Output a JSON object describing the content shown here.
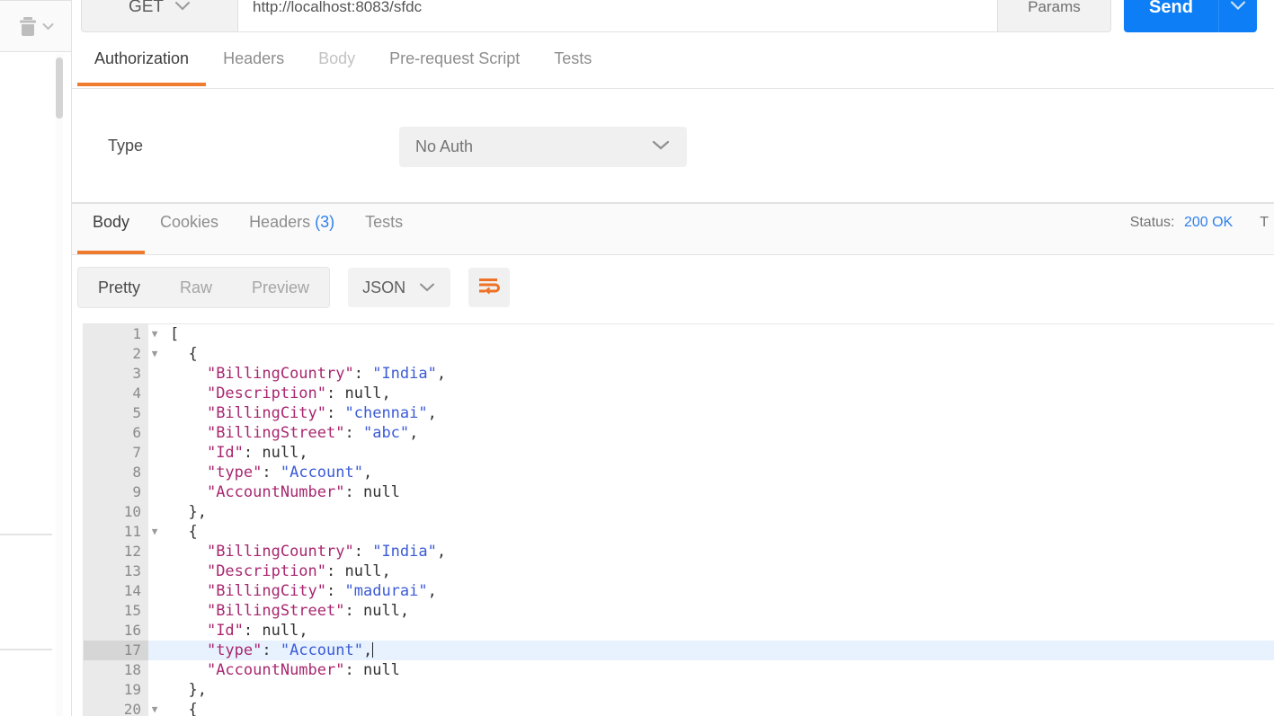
{
  "sidebar": {
    "trash_icon": "trash-icon",
    "trash_caret_icon": "chevron-down-icon"
  },
  "request": {
    "method": "GET",
    "method_caret_icon": "chevron-down-icon",
    "url": "http://localhost:8083/sfdc",
    "params_label": "Params",
    "send_label": "Send",
    "send_caret_icon": "chevron-down-icon",
    "tabs": [
      {
        "label": "Authorization",
        "state": "active"
      },
      {
        "label": "Headers",
        "state": "normal"
      },
      {
        "label": "Body",
        "state": "dim"
      },
      {
        "label": "Pre-request Script",
        "state": "normal"
      },
      {
        "label": "Tests",
        "state": "normal"
      }
    ]
  },
  "auth": {
    "type_label": "Type",
    "type_value": "No Auth",
    "caret_icon": "chevron-down-icon"
  },
  "response": {
    "tabs": [
      {
        "label": "Body",
        "count": "",
        "state": "active"
      },
      {
        "label": "Cookies",
        "count": "",
        "state": "normal"
      },
      {
        "label": "Headers",
        "count": "(3)",
        "state": "normal"
      },
      {
        "label": "Tests",
        "count": "",
        "state": "normal"
      }
    ],
    "status_label": "Status:",
    "status_value": "200 OK",
    "time_label": "T",
    "view_modes": [
      {
        "label": "Pretty",
        "state": "active"
      },
      {
        "label": "Raw",
        "state": "normal"
      },
      {
        "label": "Preview",
        "state": "normal"
      }
    ],
    "format": "JSON",
    "format_caret_icon": "chevron-down-icon",
    "wrap_icon": "word-wrap-icon"
  },
  "code": {
    "active_line": 17,
    "lines": [
      {
        "n": "1",
        "fold": true,
        "indent": 0,
        "tokens": [
          {
            "t": "punct",
            "v": "["
          }
        ]
      },
      {
        "n": "2",
        "fold": true,
        "indent": 1,
        "tokens": [
          {
            "t": "punct",
            "v": "{"
          }
        ]
      },
      {
        "n": "3",
        "fold": false,
        "indent": 2,
        "tokens": [
          {
            "t": "key",
            "v": "\"BillingCountry\""
          },
          {
            "t": "punct",
            "v": ": "
          },
          {
            "t": "str",
            "v": "\"India\""
          },
          {
            "t": "punct",
            "v": ","
          }
        ]
      },
      {
        "n": "4",
        "fold": false,
        "indent": 2,
        "tokens": [
          {
            "t": "key",
            "v": "\"Description\""
          },
          {
            "t": "punct",
            "v": ": "
          },
          {
            "t": "null",
            "v": "null"
          },
          {
            "t": "punct",
            "v": ","
          }
        ]
      },
      {
        "n": "5",
        "fold": false,
        "indent": 2,
        "tokens": [
          {
            "t": "key",
            "v": "\"BillingCity\""
          },
          {
            "t": "punct",
            "v": ": "
          },
          {
            "t": "str",
            "v": "\"chennai\""
          },
          {
            "t": "punct",
            "v": ","
          }
        ]
      },
      {
        "n": "6",
        "fold": false,
        "indent": 2,
        "tokens": [
          {
            "t": "key",
            "v": "\"BillingStreet\""
          },
          {
            "t": "punct",
            "v": ": "
          },
          {
            "t": "str",
            "v": "\"abc\""
          },
          {
            "t": "punct",
            "v": ","
          }
        ]
      },
      {
        "n": "7",
        "fold": false,
        "indent": 2,
        "tokens": [
          {
            "t": "key",
            "v": "\"Id\""
          },
          {
            "t": "punct",
            "v": ": "
          },
          {
            "t": "null",
            "v": "null"
          },
          {
            "t": "punct",
            "v": ","
          }
        ]
      },
      {
        "n": "8",
        "fold": false,
        "indent": 2,
        "tokens": [
          {
            "t": "key",
            "v": "\"type\""
          },
          {
            "t": "punct",
            "v": ": "
          },
          {
            "t": "str",
            "v": "\"Account\""
          },
          {
            "t": "punct",
            "v": ","
          }
        ]
      },
      {
        "n": "9",
        "fold": false,
        "indent": 2,
        "tokens": [
          {
            "t": "key",
            "v": "\"AccountNumber\""
          },
          {
            "t": "punct",
            "v": ": "
          },
          {
            "t": "null",
            "v": "null"
          }
        ]
      },
      {
        "n": "10",
        "fold": false,
        "indent": 1,
        "tokens": [
          {
            "t": "punct",
            "v": "},"
          }
        ]
      },
      {
        "n": "11",
        "fold": true,
        "indent": 1,
        "tokens": [
          {
            "t": "punct",
            "v": "{"
          }
        ]
      },
      {
        "n": "12",
        "fold": false,
        "indent": 2,
        "tokens": [
          {
            "t": "key",
            "v": "\"BillingCountry\""
          },
          {
            "t": "punct",
            "v": ": "
          },
          {
            "t": "str",
            "v": "\"India\""
          },
          {
            "t": "punct",
            "v": ","
          }
        ]
      },
      {
        "n": "13",
        "fold": false,
        "indent": 2,
        "tokens": [
          {
            "t": "key",
            "v": "\"Description\""
          },
          {
            "t": "punct",
            "v": ": "
          },
          {
            "t": "null",
            "v": "null"
          },
          {
            "t": "punct",
            "v": ","
          }
        ]
      },
      {
        "n": "14",
        "fold": false,
        "indent": 2,
        "tokens": [
          {
            "t": "key",
            "v": "\"BillingCity\""
          },
          {
            "t": "punct",
            "v": ": "
          },
          {
            "t": "str",
            "v": "\"madurai\""
          },
          {
            "t": "punct",
            "v": ","
          }
        ]
      },
      {
        "n": "15",
        "fold": false,
        "indent": 2,
        "tokens": [
          {
            "t": "key",
            "v": "\"BillingStreet\""
          },
          {
            "t": "punct",
            "v": ": "
          },
          {
            "t": "null",
            "v": "null"
          },
          {
            "t": "punct",
            "v": ","
          }
        ]
      },
      {
        "n": "16",
        "fold": false,
        "indent": 2,
        "tokens": [
          {
            "t": "key",
            "v": "\"Id\""
          },
          {
            "t": "punct",
            "v": ": "
          },
          {
            "t": "null",
            "v": "null"
          },
          {
            "t": "punct",
            "v": ","
          }
        ]
      },
      {
        "n": "17",
        "fold": false,
        "indent": 2,
        "caret": true,
        "tokens": [
          {
            "t": "key",
            "v": "\"type\""
          },
          {
            "t": "punct",
            "v": ": "
          },
          {
            "t": "str",
            "v": "\"Account\""
          },
          {
            "t": "punct",
            "v": ","
          }
        ]
      },
      {
        "n": "18",
        "fold": false,
        "indent": 2,
        "tokens": [
          {
            "t": "key",
            "v": "\"AccountNumber\""
          },
          {
            "t": "punct",
            "v": ": "
          },
          {
            "t": "null",
            "v": "null"
          }
        ]
      },
      {
        "n": "19",
        "fold": false,
        "indent": 1,
        "tokens": [
          {
            "t": "punct",
            "v": "},"
          }
        ]
      },
      {
        "n": "20",
        "fold": true,
        "indent": 1,
        "tokens": [
          {
            "t": "punct",
            "v": "{"
          }
        ]
      }
    ]
  },
  "colors": {
    "accent_orange": "#ef7b2e",
    "send_blue": "#0d7ef5",
    "status_blue": "#2f80ed",
    "key_purple": "#a8276f",
    "string_blue": "#3b5bd6"
  }
}
